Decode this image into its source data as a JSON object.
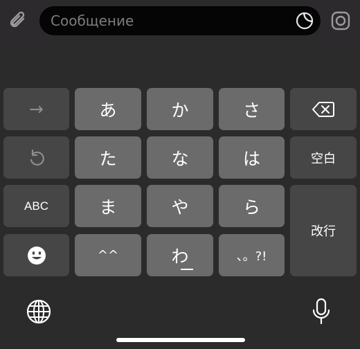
{
  "message_bar": {
    "placeholder": "Сообщение",
    "icons": [
      "paperclip-icon",
      "sticker-icon",
      "camera-icon"
    ]
  },
  "keyboard": {
    "rows": [
      [
        "→",
        "あ",
        "か",
        "さ",
        "⌫"
      ],
      [
        "↺",
        "た",
        "な",
        "は",
        "空白"
      ],
      [
        "ABC",
        "ま",
        "や",
        "ら",
        "改行"
      ],
      [
        "☻",
        "^^",
        "わ",
        "、。?!"
      ]
    ],
    "next_label": "→",
    "a": "あ",
    "ka": "か",
    "sa": "さ",
    "ta": "た",
    "na": "な",
    "ha": "は",
    "space": "空白",
    "abc": "ABC",
    "ma": "ま",
    "ya": "や",
    "ra": "ら",
    "return": "改行",
    "kaomoji": "^^",
    "wa": "わ",
    "punct": "、。?!"
  },
  "bottom_bar": {
    "icons": [
      "globe-icon",
      "microphone-icon"
    ]
  },
  "colors": {
    "keyboard_bg": "#2b2b2b",
    "func_key": "#464646",
    "kana_key": "#6b6b6b",
    "field_bg": "#050505",
    "placeholder": "#7d7d82"
  }
}
